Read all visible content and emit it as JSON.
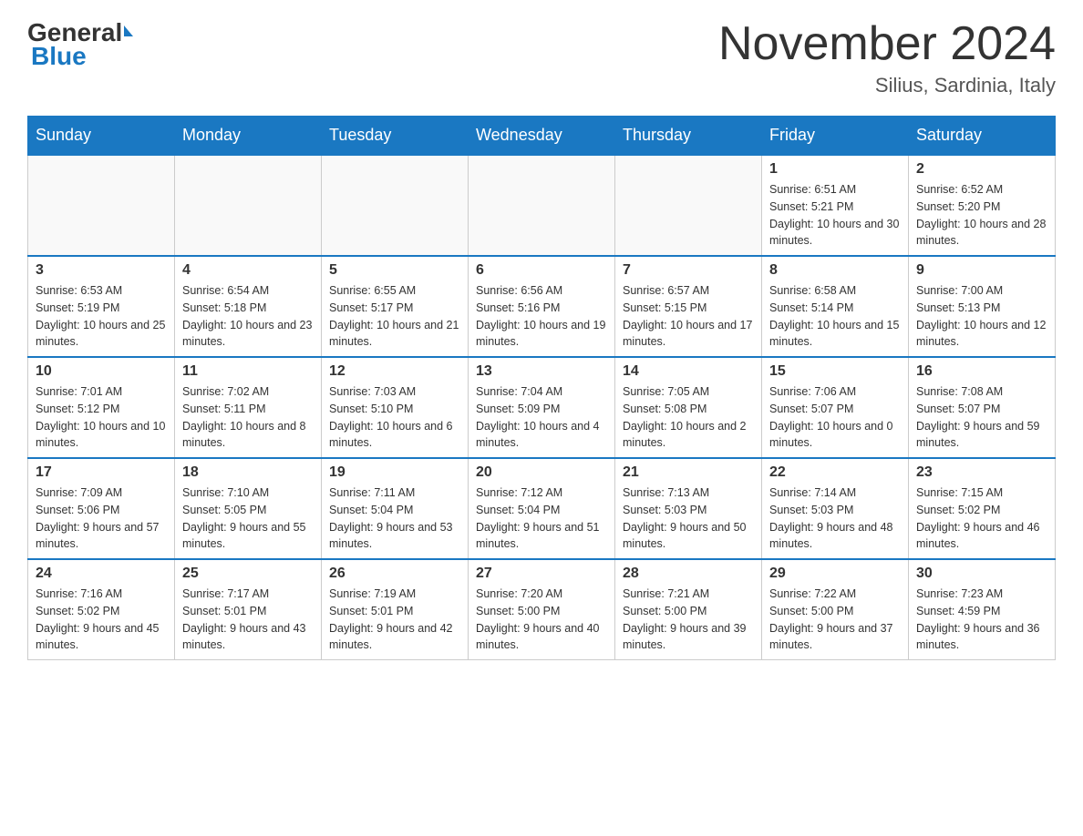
{
  "header": {
    "logo_general": "General",
    "logo_blue": "Blue",
    "month_title": "November 2024",
    "location": "Silius, Sardinia, Italy"
  },
  "days_of_week": [
    "Sunday",
    "Monday",
    "Tuesday",
    "Wednesday",
    "Thursday",
    "Friday",
    "Saturday"
  ],
  "weeks": [
    [
      {
        "day": "",
        "sunrise": "",
        "sunset": "",
        "daylight": "",
        "empty": true
      },
      {
        "day": "",
        "sunrise": "",
        "sunset": "",
        "daylight": "",
        "empty": true
      },
      {
        "day": "",
        "sunrise": "",
        "sunset": "",
        "daylight": "",
        "empty": true
      },
      {
        "day": "",
        "sunrise": "",
        "sunset": "",
        "daylight": "",
        "empty": true
      },
      {
        "day": "",
        "sunrise": "",
        "sunset": "",
        "daylight": "",
        "empty": true
      },
      {
        "day": "1",
        "sunrise": "Sunrise: 6:51 AM",
        "sunset": "Sunset: 5:21 PM",
        "daylight": "Daylight: 10 hours and 30 minutes.",
        "empty": false
      },
      {
        "day": "2",
        "sunrise": "Sunrise: 6:52 AM",
        "sunset": "Sunset: 5:20 PM",
        "daylight": "Daylight: 10 hours and 28 minutes.",
        "empty": false
      }
    ],
    [
      {
        "day": "3",
        "sunrise": "Sunrise: 6:53 AM",
        "sunset": "Sunset: 5:19 PM",
        "daylight": "Daylight: 10 hours and 25 minutes.",
        "empty": false
      },
      {
        "day": "4",
        "sunrise": "Sunrise: 6:54 AM",
        "sunset": "Sunset: 5:18 PM",
        "daylight": "Daylight: 10 hours and 23 minutes.",
        "empty": false
      },
      {
        "day": "5",
        "sunrise": "Sunrise: 6:55 AM",
        "sunset": "Sunset: 5:17 PM",
        "daylight": "Daylight: 10 hours and 21 minutes.",
        "empty": false
      },
      {
        "day": "6",
        "sunrise": "Sunrise: 6:56 AM",
        "sunset": "Sunset: 5:16 PM",
        "daylight": "Daylight: 10 hours and 19 minutes.",
        "empty": false
      },
      {
        "day": "7",
        "sunrise": "Sunrise: 6:57 AM",
        "sunset": "Sunset: 5:15 PM",
        "daylight": "Daylight: 10 hours and 17 minutes.",
        "empty": false
      },
      {
        "day": "8",
        "sunrise": "Sunrise: 6:58 AM",
        "sunset": "Sunset: 5:14 PM",
        "daylight": "Daylight: 10 hours and 15 minutes.",
        "empty": false
      },
      {
        "day": "9",
        "sunrise": "Sunrise: 7:00 AM",
        "sunset": "Sunset: 5:13 PM",
        "daylight": "Daylight: 10 hours and 12 minutes.",
        "empty": false
      }
    ],
    [
      {
        "day": "10",
        "sunrise": "Sunrise: 7:01 AM",
        "sunset": "Sunset: 5:12 PM",
        "daylight": "Daylight: 10 hours and 10 minutes.",
        "empty": false
      },
      {
        "day": "11",
        "sunrise": "Sunrise: 7:02 AM",
        "sunset": "Sunset: 5:11 PM",
        "daylight": "Daylight: 10 hours and 8 minutes.",
        "empty": false
      },
      {
        "day": "12",
        "sunrise": "Sunrise: 7:03 AM",
        "sunset": "Sunset: 5:10 PM",
        "daylight": "Daylight: 10 hours and 6 minutes.",
        "empty": false
      },
      {
        "day": "13",
        "sunrise": "Sunrise: 7:04 AM",
        "sunset": "Sunset: 5:09 PM",
        "daylight": "Daylight: 10 hours and 4 minutes.",
        "empty": false
      },
      {
        "day": "14",
        "sunrise": "Sunrise: 7:05 AM",
        "sunset": "Sunset: 5:08 PM",
        "daylight": "Daylight: 10 hours and 2 minutes.",
        "empty": false
      },
      {
        "day": "15",
        "sunrise": "Sunrise: 7:06 AM",
        "sunset": "Sunset: 5:07 PM",
        "daylight": "Daylight: 10 hours and 0 minutes.",
        "empty": false
      },
      {
        "day": "16",
        "sunrise": "Sunrise: 7:08 AM",
        "sunset": "Sunset: 5:07 PM",
        "daylight": "Daylight: 9 hours and 59 minutes.",
        "empty": false
      }
    ],
    [
      {
        "day": "17",
        "sunrise": "Sunrise: 7:09 AM",
        "sunset": "Sunset: 5:06 PM",
        "daylight": "Daylight: 9 hours and 57 minutes.",
        "empty": false
      },
      {
        "day": "18",
        "sunrise": "Sunrise: 7:10 AM",
        "sunset": "Sunset: 5:05 PM",
        "daylight": "Daylight: 9 hours and 55 minutes.",
        "empty": false
      },
      {
        "day": "19",
        "sunrise": "Sunrise: 7:11 AM",
        "sunset": "Sunset: 5:04 PM",
        "daylight": "Daylight: 9 hours and 53 minutes.",
        "empty": false
      },
      {
        "day": "20",
        "sunrise": "Sunrise: 7:12 AM",
        "sunset": "Sunset: 5:04 PM",
        "daylight": "Daylight: 9 hours and 51 minutes.",
        "empty": false
      },
      {
        "day": "21",
        "sunrise": "Sunrise: 7:13 AM",
        "sunset": "Sunset: 5:03 PM",
        "daylight": "Daylight: 9 hours and 50 minutes.",
        "empty": false
      },
      {
        "day": "22",
        "sunrise": "Sunrise: 7:14 AM",
        "sunset": "Sunset: 5:03 PM",
        "daylight": "Daylight: 9 hours and 48 minutes.",
        "empty": false
      },
      {
        "day": "23",
        "sunrise": "Sunrise: 7:15 AM",
        "sunset": "Sunset: 5:02 PM",
        "daylight": "Daylight: 9 hours and 46 minutes.",
        "empty": false
      }
    ],
    [
      {
        "day": "24",
        "sunrise": "Sunrise: 7:16 AM",
        "sunset": "Sunset: 5:02 PM",
        "daylight": "Daylight: 9 hours and 45 minutes.",
        "empty": false
      },
      {
        "day": "25",
        "sunrise": "Sunrise: 7:17 AM",
        "sunset": "Sunset: 5:01 PM",
        "daylight": "Daylight: 9 hours and 43 minutes.",
        "empty": false
      },
      {
        "day": "26",
        "sunrise": "Sunrise: 7:19 AM",
        "sunset": "Sunset: 5:01 PM",
        "daylight": "Daylight: 9 hours and 42 minutes.",
        "empty": false
      },
      {
        "day": "27",
        "sunrise": "Sunrise: 7:20 AM",
        "sunset": "Sunset: 5:00 PM",
        "daylight": "Daylight: 9 hours and 40 minutes.",
        "empty": false
      },
      {
        "day": "28",
        "sunrise": "Sunrise: 7:21 AM",
        "sunset": "Sunset: 5:00 PM",
        "daylight": "Daylight: 9 hours and 39 minutes.",
        "empty": false
      },
      {
        "day": "29",
        "sunrise": "Sunrise: 7:22 AM",
        "sunset": "Sunset: 5:00 PM",
        "daylight": "Daylight: 9 hours and 37 minutes.",
        "empty": false
      },
      {
        "day": "30",
        "sunrise": "Sunrise: 7:23 AM",
        "sunset": "Sunset: 4:59 PM",
        "daylight": "Daylight: 9 hours and 36 minutes.",
        "empty": false
      }
    ]
  ]
}
